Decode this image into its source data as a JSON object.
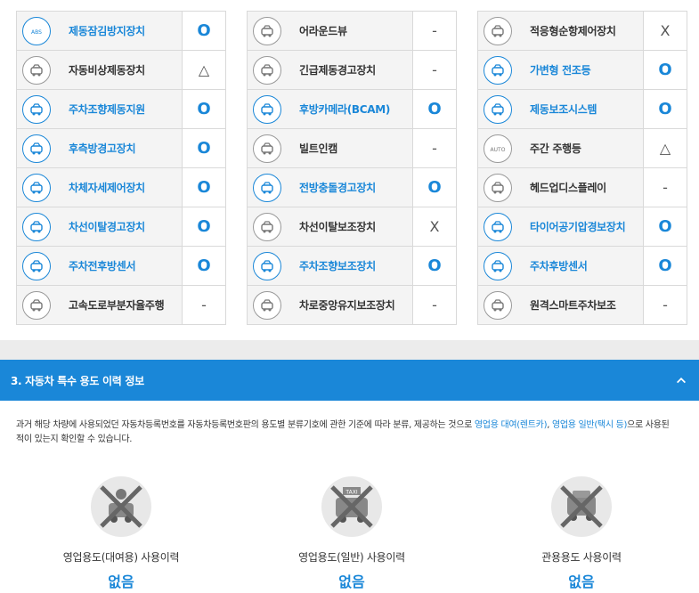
{
  "features": {
    "col1": [
      {
        "label": "제동잠김방지장치",
        "status": "O",
        "on": true,
        "icon": "abs-icon",
        "icon_text": "ABS"
      },
      {
        "label": "자동비상제동장치",
        "status": "△",
        "on": false,
        "icon": "emergency-brake-icon"
      },
      {
        "label": "주차조향제동지원",
        "status": "O",
        "on": true,
        "icon": "parking-steering-icon"
      },
      {
        "label": "후측방경고장치",
        "status": "O",
        "on": true,
        "icon": "rear-side-warning-icon"
      },
      {
        "label": "차체자세제어장치",
        "status": "O",
        "on": true,
        "icon": "stability-control-icon"
      },
      {
        "label": "차선이탈경고장치",
        "status": "O",
        "on": true,
        "icon": "lane-departure-warning-icon"
      },
      {
        "label": "주차전후방센서",
        "status": "O",
        "on": true,
        "icon": "parking-sensor-icon"
      },
      {
        "label": "고속도로부분자율주행",
        "status": "-",
        "on": false,
        "icon": "highway-autopilot-icon"
      }
    ],
    "col2": [
      {
        "label": "어라운드뷰",
        "status": "-",
        "on": false,
        "icon": "around-view-icon"
      },
      {
        "label": "긴급제동경고장치",
        "status": "-",
        "on": false,
        "icon": "emergency-brake-warning-icon"
      },
      {
        "label": "후방카메라(BCAM)",
        "status": "O",
        "on": true,
        "icon": "rear-camera-icon"
      },
      {
        "label": "빌트인캠",
        "status": "-",
        "on": false,
        "icon": "builtin-cam-icon"
      },
      {
        "label": "전방충돌경고장치",
        "status": "O",
        "on": true,
        "icon": "forward-collision-icon"
      },
      {
        "label": "차선이탈보조장치",
        "status": "X",
        "on": false,
        "icon": "lane-keeping-assist-icon"
      },
      {
        "label": "주차조향보조장치",
        "status": "O",
        "on": true,
        "icon": "parking-assist-icon"
      },
      {
        "label": "차로중앙유지보조장치",
        "status": "-",
        "on": false,
        "icon": "lane-centering-icon"
      }
    ],
    "col3": [
      {
        "label": "적응형순항제어장치",
        "status": "X",
        "on": false,
        "icon": "adaptive-cruise-icon"
      },
      {
        "label": "가변형 전조등",
        "status": "O",
        "on": true,
        "icon": "adaptive-headlight-icon"
      },
      {
        "label": "제동보조시스템",
        "status": "O",
        "on": true,
        "icon": "brake-assist-icon"
      },
      {
        "label": "주간 주행등",
        "status": "△",
        "on": false,
        "icon": "daytime-running-light-icon",
        "icon_text": "AUTO"
      },
      {
        "label": "헤드업디스플레이",
        "status": "-",
        "on": false,
        "icon": "hud-icon"
      },
      {
        "label": "타이어공기압경보장치",
        "status": "O",
        "on": true,
        "icon": "tpms-icon"
      },
      {
        "label": "주차후방센서",
        "status": "O",
        "on": true,
        "icon": "rear-parking-sensor-icon"
      },
      {
        "label": "원격스마트주차보조",
        "status": "-",
        "on": false,
        "icon": "remote-parking-icon"
      }
    ]
  },
  "section": {
    "title": "3. 자동차 특수 용도 이력 정보",
    "desc_prefix": "과거 해당 차량에 사용되었던 자동차등록번호를 자동차등록번호판의 용도별 분류기호에 관한 기준에 따라 분류, 제공하는 것으로 ",
    "desc_hl1": "영업용 대여(렌트카)",
    "desc_sep": ", ",
    "desc_hl2": "영업용 일반(택시 등)",
    "desc_suffix": "으로 사용된 적이 있는지 확인할 수 있습니다."
  },
  "usage": [
    {
      "label": "영업용도(대여용) 사용이력",
      "value": "없음",
      "icon": "rental-car-crossed-icon"
    },
    {
      "label": "영업용도(일반) 사용이력",
      "value": "없음",
      "icon": "taxi-crossed-icon",
      "icon_text": "TAXI"
    },
    {
      "label": "관용용도 사용이력",
      "value": "없음",
      "icon": "government-car-crossed-icon"
    }
  ],
  "colors": {
    "accent": "#1a87d8",
    "section_bg": "#1a87d8",
    "cell_bg": "#f4f4f4",
    "border": "#d9d9d9"
  }
}
